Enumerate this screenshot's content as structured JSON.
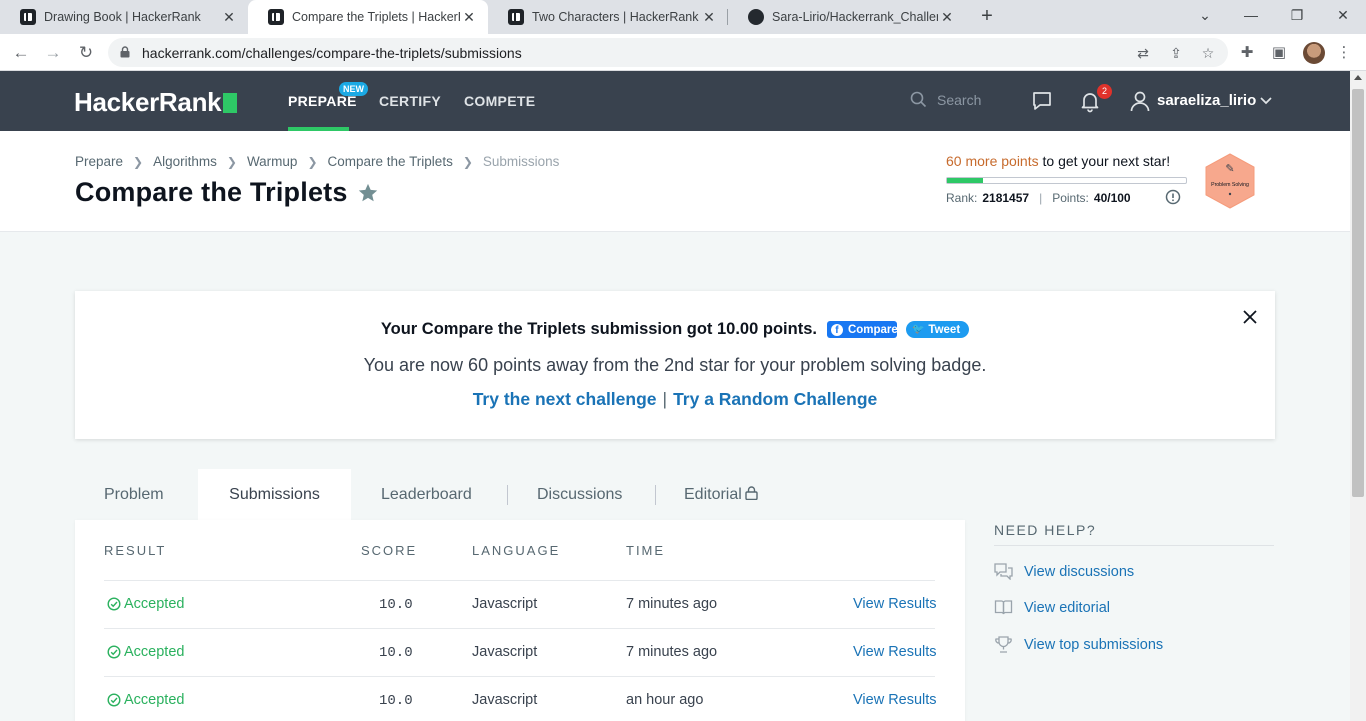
{
  "browser": {
    "tabs": [
      {
        "title": "Drawing Book | HackerRank",
        "icon": "hackerrank-favicon",
        "active": false
      },
      {
        "title": "Compare the Triplets | HackerRank",
        "icon": "hackerrank-favicon",
        "active": true
      },
      {
        "title": "Two Characters | HackerRank",
        "icon": "hackerrank-favicon",
        "active": false
      },
      {
        "title": "Sara-Lirio/Hackerrank_Challenges",
        "icon": "github-favicon",
        "active": false
      }
    ],
    "url": "hackerrank.com/challenges/compare-the-triplets/submissions"
  },
  "navbar": {
    "logo": "HackerRank",
    "links": {
      "prepare": "PREPARE",
      "certify": "CERTIFY",
      "compete": "COMPETE"
    },
    "new_badge": "NEW",
    "search_placeholder": "Search",
    "notification_count": "2",
    "username": "saraeliza_lirio"
  },
  "breadcrumb": {
    "prepare": "Prepare",
    "algorithms": "Algorithms",
    "warmup": "Warmup",
    "challenge": "Compare the Triplets",
    "current": "Submissions"
  },
  "page_title": "Compare the Triplets",
  "progress": {
    "highlight": "60 more points",
    "rest": " to get your next star!",
    "fraction": 0.15,
    "rank_label": "Rank:",
    "rank_value": "2181457",
    "points_label": "Points:",
    "points_value": "40/100",
    "badge_label": "Problem Solving"
  },
  "banner": {
    "headline": "Your Compare the Triplets submission got 10.00 points.",
    "facebook_label": "Compare",
    "tweet_label": "Tweet",
    "subline": "You are now 60 points away from the 2nd star for your problem solving badge.",
    "next_link": "Try the next challenge",
    "separator": "|",
    "random_link": "Try a Random Challenge"
  },
  "tabs": {
    "problem": "Problem",
    "submissions": "Submissions",
    "leaderboard": "Leaderboard",
    "discussions": "Discussions",
    "editorial": "Editorial"
  },
  "table": {
    "headers": {
      "result": "RESULT",
      "score": "SCORE",
      "language": "LANGUAGE",
      "time": "TIME"
    },
    "rows": [
      {
        "result": "Accepted",
        "score": "10.0",
        "language": "Javascript",
        "time": "7 minutes ago",
        "action": "View Results"
      },
      {
        "result": "Accepted",
        "score": "10.0",
        "language": "Javascript",
        "time": "7 minutes ago",
        "action": "View Results"
      },
      {
        "result": "Accepted",
        "score": "10.0",
        "language": "Javascript",
        "time": "an hour ago",
        "action": "View Results"
      }
    ]
  },
  "help": {
    "title": "NEED HELP?",
    "items": [
      {
        "label": "View discussions",
        "icon": "discussions-icon"
      },
      {
        "label": "View editorial",
        "icon": "book-icon"
      },
      {
        "label": "View top submissions",
        "icon": "trophy-icon"
      }
    ]
  },
  "colors": {
    "navbar": "#39424e",
    "accent_green": "#2ec866",
    "link_blue": "#1a73b6",
    "accepted_green": "#2ab15e",
    "highlight_orange": "#c76b2d"
  }
}
